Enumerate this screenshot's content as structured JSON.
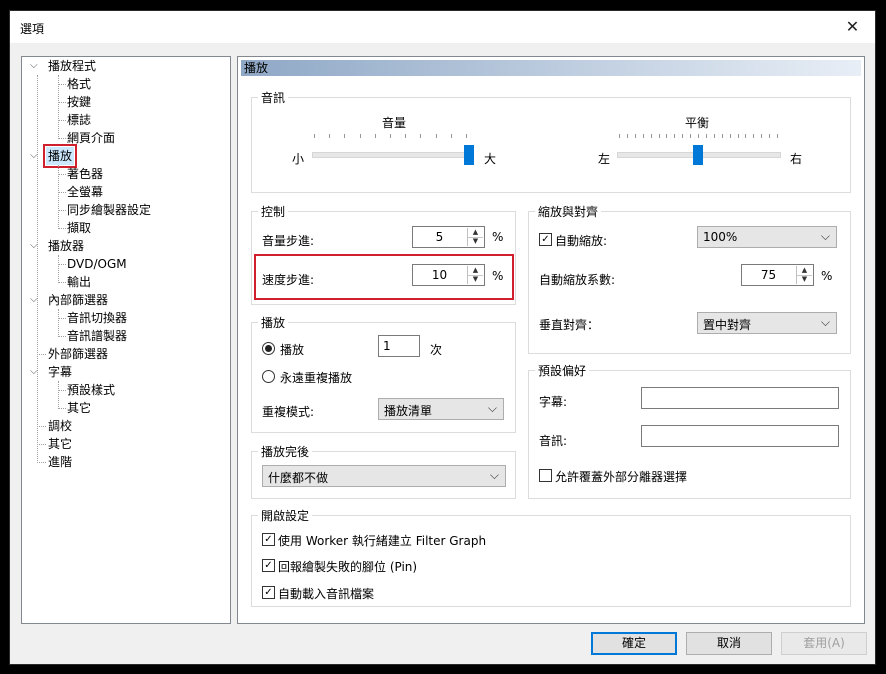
{
  "window": {
    "title": "選項",
    "close_glyph": "✕"
  },
  "tree": {
    "items": [
      {
        "label": "播放程式",
        "level": 0,
        "expanded": true
      },
      {
        "label": "格式",
        "level": 1
      },
      {
        "label": "按鍵",
        "level": 1
      },
      {
        "label": "標誌",
        "level": 1
      },
      {
        "label": "網頁介面",
        "level": 1
      },
      {
        "label": "播放",
        "level": 0,
        "expanded": true,
        "selected": true
      },
      {
        "label": "著色器",
        "level": 1
      },
      {
        "label": "全螢幕",
        "level": 1
      },
      {
        "label": "同步繪製器設定",
        "level": 1
      },
      {
        "label": "擷取",
        "level": 1
      },
      {
        "label": "播放器",
        "level": 0,
        "expanded": true
      },
      {
        "label": "DVD/OGM",
        "level": 1
      },
      {
        "label": "輸出",
        "level": 1
      },
      {
        "label": "內部篩選器",
        "level": 0,
        "expanded": true
      },
      {
        "label": "音訊切換器",
        "level": 1
      },
      {
        "label": "音訊譜製器",
        "level": 1
      },
      {
        "label": "外部篩選器",
        "level": 0
      },
      {
        "label": "字幕",
        "level": 0,
        "expanded": true
      },
      {
        "label": "預設樣式",
        "level": 1
      },
      {
        "label": "其它",
        "level": 1
      },
      {
        "label": "調校",
        "level": 0
      },
      {
        "label": "其它",
        "level": 0
      },
      {
        "label": "進階",
        "level": 0
      }
    ]
  },
  "panel": {
    "header": "播放",
    "audio": {
      "title": "音訊",
      "volume": {
        "label": "音量",
        "min_label": "小",
        "max_label": "大",
        "value": 0.97
      },
      "balance": {
        "label": "平衡",
        "min_label": "左",
        "max_label": "右",
        "value": 0.5
      }
    },
    "control": {
      "title": "控制",
      "volume_step": {
        "label": "音量步進:",
        "value": "5",
        "unit": "%"
      },
      "speed_step": {
        "label": "速度步進:",
        "value": "10",
        "unit": "%"
      }
    },
    "zoom": {
      "title": "縮放與對齊",
      "auto_zoom": {
        "label": "自動縮放:",
        "checked": true,
        "value": "100%"
      },
      "auto_zoom_factor": {
        "label": "自動縮放系數:",
        "value": "75",
        "unit": "%"
      },
      "vertical_align": {
        "label": "垂直對齊：",
        "value": "置中對齊"
      }
    },
    "playback": {
      "title": "播放",
      "play_radio": {
        "label": "播放",
        "selected": true,
        "count": "1",
        "unit": "次"
      },
      "repeat_radio": {
        "label": "永遠重複播放",
        "selected": false
      },
      "repeat_mode": {
        "label": "重複模式:",
        "value": "播放清單"
      }
    },
    "after_playback": {
      "title": "播放完後",
      "value": "什麼都不做"
    },
    "preferences": {
      "title": "預設偏好",
      "subtitle": {
        "label": "字幕:",
        "value": ""
      },
      "audio": {
        "label": "音訊:",
        "value": ""
      },
      "override_splitter": {
        "label": "允許覆蓋外部分離器選擇",
        "checked": false
      }
    },
    "open_settings": {
      "title": "開啟設定",
      "items": [
        {
          "label": "使用 Worker 執行緒建立 Filter Graph",
          "checked": true
        },
        {
          "label": "回報繪製失敗的腳位 (Pin)",
          "checked": true
        },
        {
          "label": "自動載入音訊檔案",
          "checked": true
        }
      ]
    }
  },
  "buttons": {
    "ok": "確定",
    "cancel": "取消",
    "apply": "套用(A)"
  },
  "colors": {
    "accent": "#0078d7",
    "highlight": "#d0202e",
    "selected_bg": "#cce8ff"
  }
}
